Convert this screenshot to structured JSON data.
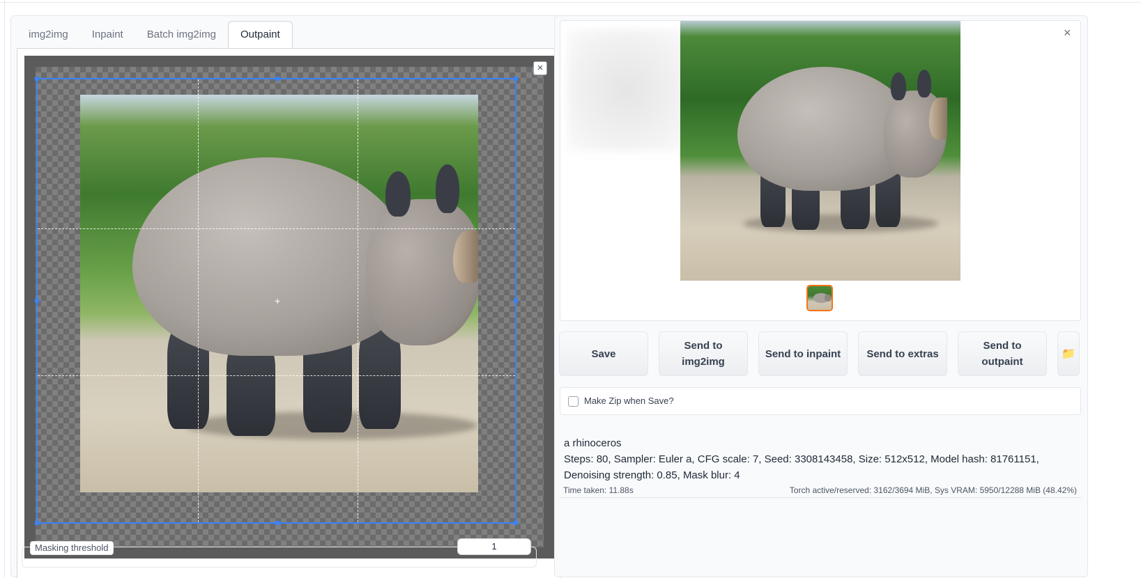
{
  "tabs": [
    {
      "label": "img2img"
    },
    {
      "label": "Inpaint"
    },
    {
      "label": "Batch img2img"
    },
    {
      "label": "Outpaint"
    }
  ],
  "active_tab": "Outpaint",
  "canvas": {
    "close_symbol": "×",
    "crosshair_symbol": "+",
    "selection_color": "#3b82f6"
  },
  "masking": {
    "label": "Masking threshold",
    "value": "1"
  },
  "gallery": {
    "close_symbol": "×"
  },
  "actions": {
    "save": "Save",
    "send_img2img": "Send to img2img",
    "send_inpaint": "Send to inpaint",
    "send_extras": "Send to extras",
    "send_outpaint": "Send to outpaint",
    "folder_icon": "📁"
  },
  "zip": {
    "label": "Make Zip when Save?"
  },
  "info": {
    "prompt": "a rhinoceros",
    "params": "Steps: 80, Sampler: Euler a, CFG scale: 7, Seed: 3308143458, Size: 512x512, Model hash: 81761151, Denoising strength: 0.85, Mask blur: 4",
    "time_taken": "Time taken: 11.88s",
    "vram": "Torch active/reserved: 3162/3694 MiB, Sys VRAM: 5950/12288 MiB (48.42%)"
  },
  "colors": {
    "accent": "#f97316",
    "selection": "#3b82f6"
  }
}
